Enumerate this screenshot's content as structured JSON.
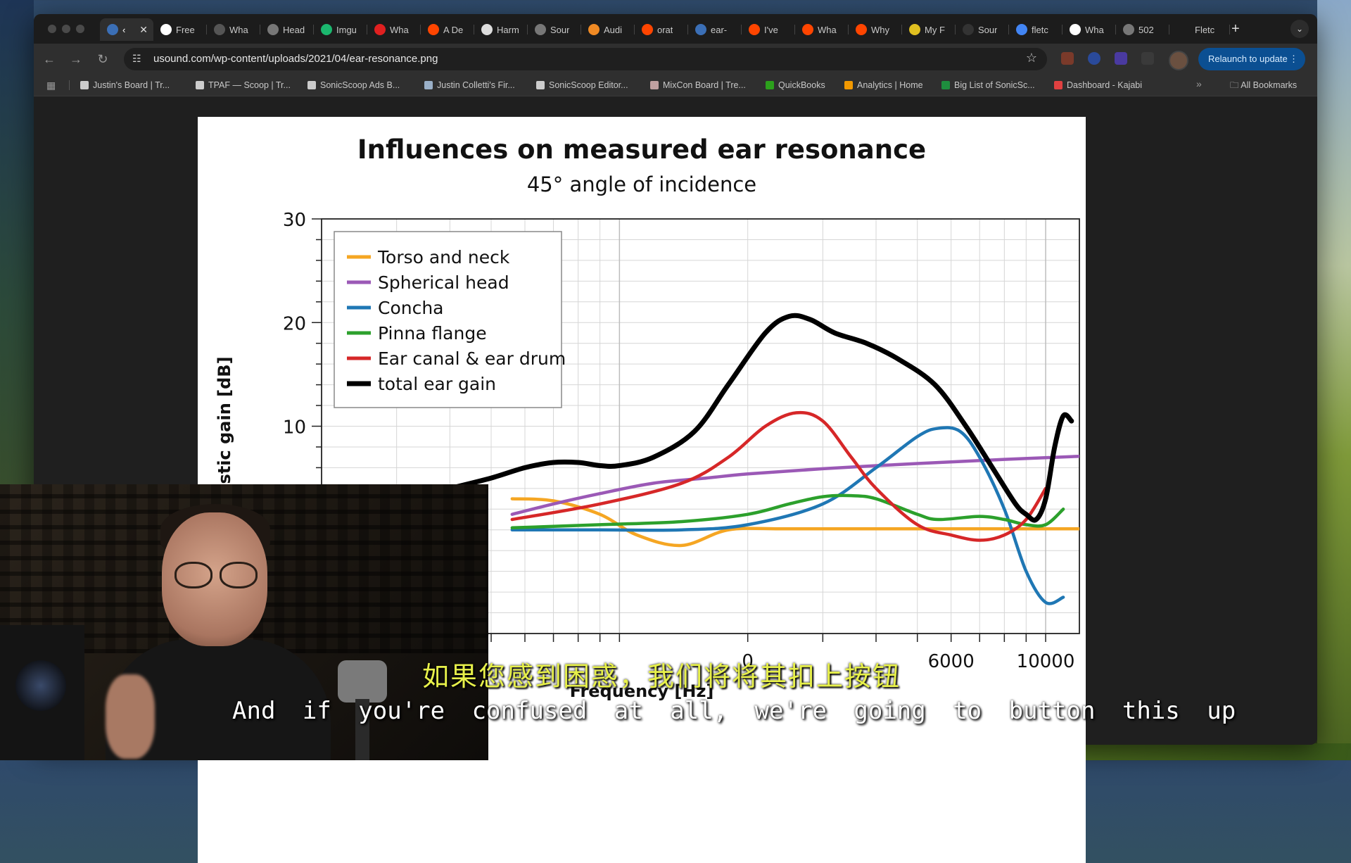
{
  "browser": {
    "tabs": [
      {
        "label": "‹",
        "icon": "wordpress-icon",
        "color": "#3b6fb6",
        "active": true
      },
      {
        "label": "Free",
        "icon": "r-logo-icon",
        "color": "#ffffff"
      },
      {
        "label": "Wha",
        "icon": "github-icon",
        "color": "#555555"
      },
      {
        "label": "Head",
        "icon": "globe-icon",
        "color": "#777777"
      },
      {
        "label": "Imgu",
        "icon": "imgur-icon",
        "color": "#1bb76e"
      },
      {
        "label": "Wha",
        "icon": "youtube-icon",
        "color": "#e02020"
      },
      {
        "label": "A De",
        "icon": "reddit-icon",
        "color": "#ff4500"
      },
      {
        "label": "Harm",
        "icon": "page-icon",
        "color": "#dddddd"
      },
      {
        "label": "Sour",
        "icon": "globe-icon",
        "color": "#777777"
      },
      {
        "label": "Audi",
        "icon": "b-logo-icon",
        "color": "#f08a24"
      },
      {
        "label": "orat",
        "icon": "reddit-icon",
        "color": "#ff4500"
      },
      {
        "label": "ear-",
        "icon": "wordpress-icon",
        "color": "#3b6fb6"
      },
      {
        "label": "I've",
        "icon": "reddit-icon",
        "color": "#ff4500"
      },
      {
        "label": "Wha",
        "icon": "reddit-icon",
        "color": "#ff4500"
      },
      {
        "label": "Why",
        "icon": "reddit-icon",
        "color": "#ff4500"
      },
      {
        "label": "My F",
        "icon": "shield-icon",
        "color": "#e0c020"
      },
      {
        "label": "Sour",
        "icon": "gear-icon",
        "color": "#333333"
      },
      {
        "label": "fletc",
        "icon": "google-icon",
        "color": "#4285f4"
      },
      {
        "label": "Wha",
        "icon": "openai-icon",
        "color": "#ffffff"
      },
      {
        "label": "502",
        "icon": "globe-icon",
        "color": "#777777"
      },
      {
        "label": "Fletc",
        "icon": "",
        "color": "#1c1c1c"
      }
    ],
    "url": "usound.com/wp-content/uploads/2021/04/ear-resonance.png",
    "relaunch_label": "Relaunch to update",
    "bookmarks": [
      {
        "label": "Justin's Board | Tr...",
        "color": "#cccccc"
      },
      {
        "label": "TPAF — Scoop | Tr...",
        "color": "#cccccc"
      },
      {
        "label": "SonicScoop Ads B...",
        "color": "#cccccc"
      },
      {
        "label": "Justin Colletti's Fir...",
        "color": "#9ab0c8"
      },
      {
        "label": "SonicScoop Editor...",
        "color": "#cccccc"
      },
      {
        "label": "MixCon Board | Tre...",
        "color": "#c0a0a0"
      },
      {
        "label": "QuickBooks",
        "color": "#2ca01c"
      },
      {
        "label": "Analytics | Home",
        "color": "#f29900"
      },
      {
        "label": "Big List of SonicSc...",
        "color": "#1e8e3e"
      },
      {
        "label": "Dashboard - Kajabi",
        "color": "#e04040"
      }
    ],
    "all_bookmarks_label": "All Bookmarks"
  },
  "chart_data": {
    "type": "line",
    "title": "Influences on measured ear resonance",
    "subtitle": "45° angle of incidence",
    "ylabel": "ustic gain [dB]",
    "xlabel": "Frequency [Hz]",
    "x_scale": "log",
    "ylim": [
      -10,
      30
    ],
    "xlim": [
      200,
      12000
    ],
    "y_ticks": [
      {
        "value": 30,
        "label": "30"
      },
      {
        "value": 20,
        "label": "20"
      },
      {
        "value": 10,
        "label": "10"
      }
    ],
    "x_ticks": [
      {
        "value": 2000,
        "label": "0"
      },
      {
        "value": 6000,
        "label": "6000"
      },
      {
        "value": 10000,
        "label": "10000"
      }
    ],
    "legend_position": "top-left",
    "grid": true,
    "series": [
      {
        "name": "Torso and neck",
        "color": "#f5a623",
        "x": [
          560,
          700,
          900,
          1100,
          1400,
          1800,
          2400,
          3500,
          5000,
          8000,
          12000
        ],
        "y": [
          3,
          2.8,
          1.5,
          -0.5,
          -1.5,
          0,
          0.1,
          0.1,
          0.1,
          0.1,
          0.1
        ]
      },
      {
        "name": "Spherical head",
        "color": "#9b59b6",
        "x": [
          560,
          700,
          900,
          1200,
          1600,
          2000,
          3000,
          5000,
          8000,
          12000
        ],
        "y": [
          1.5,
          2.5,
          3.5,
          4.5,
          5.0,
          5.4,
          5.9,
          6.4,
          6.8,
          7.1
        ]
      },
      {
        "name": "Concha",
        "color": "#1f77b4",
        "x": [
          560,
          900,
          1400,
          2000,
          3000,
          4000,
          5000,
          5600,
          6300,
          7000,
          8000,
          9000,
          10000,
          11000
        ],
        "y": [
          0,
          0,
          0,
          0.5,
          2.5,
          6,
          9,
          9.8,
          9.5,
          7,
          2,
          -4,
          -7,
          -6.5
        ]
      },
      {
        "name": "Pinna flange",
        "color": "#2ca02c",
        "x": [
          560,
          900,
          1400,
          2000,
          2500,
          3000,
          3500,
          4000,
          5000,
          5600,
          7000,
          8000,
          9000,
          10000,
          11000
        ],
        "y": [
          0.2,
          0.5,
          0.8,
          1.5,
          2.5,
          3.2,
          3.3,
          3,
          1.5,
          1,
          1.3,
          1,
          0.5,
          0.5,
          2
        ]
      },
      {
        "name": "Ear canal & ear drum",
        "color": "#d62728",
        "x": [
          560,
          900,
          1400,
          1800,
          2200,
          2600,
          3000,
          3500,
          4000,
          5000,
          6000,
          7000,
          8000,
          9000,
          10000
        ],
        "y": [
          1,
          2.5,
          4.5,
          7,
          10,
          11.3,
          10.5,
          7,
          4,
          0.5,
          -0.5,
          -1,
          -0.5,
          1,
          4
        ]
      },
      {
        "name": "total ear gain",
        "color": "#000000",
        "x": [
          400,
          500,
          600,
          700,
          800,
          900,
          1000,
          1200,
          1500,
          1800,
          2200,
          2500,
          2800,
          3200,
          3800,
          4500,
          5500,
          6500,
          7500,
          8500,
          9000,
          9500,
          10000,
          10500,
          11000,
          11500
        ],
        "y": [
          4,
          5,
          6,
          6.5,
          6.5,
          6.2,
          6.2,
          7,
          9.5,
          14,
          19,
          20.6,
          20.3,
          19,
          18,
          16.5,
          14,
          10,
          6,
          2.5,
          1.5,
          1,
          3,
          8,
          11,
          10.5
        ]
      }
    ]
  },
  "subtitles": {
    "chinese": "如果您感到困惑，我们将将其扣上按钮",
    "english": "And if you're confused at all, we're going to button this up"
  }
}
